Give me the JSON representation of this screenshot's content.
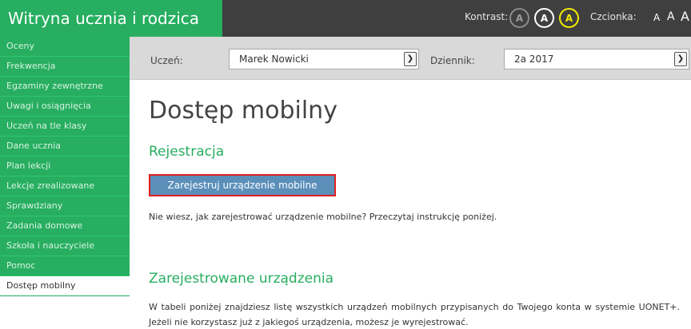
{
  "header": {
    "title": "Witryna ucznia i rodzica",
    "contrast_label": "Kontrast:",
    "contrast_options": [
      "A",
      "A",
      "A"
    ],
    "font_label": "Czcionka:",
    "font_sizes": [
      "A",
      "A",
      "A"
    ],
    "colors": {
      "brand": "#27ae60",
      "bar": "#3f3f3f",
      "contrast_active": "#f2ea00"
    }
  },
  "sidebar": {
    "items": [
      {
        "label": "Oceny"
      },
      {
        "label": "Frekwencja"
      },
      {
        "label": "Egzaminy zewnętrzne"
      },
      {
        "label": "Uwagi i osiągnięcia"
      },
      {
        "label": "Uczeń na tle klasy"
      },
      {
        "label": "Dane ucznia"
      },
      {
        "label": "Plan lekcji"
      },
      {
        "label": "Lekcje zrealizowane"
      },
      {
        "label": "Sprawdziany"
      },
      {
        "label": "Zadania domowe"
      },
      {
        "label": "Szkoła i nauczyciele"
      },
      {
        "label": "Pomoc"
      },
      {
        "label": "Dostęp mobilny",
        "active": true
      }
    ]
  },
  "filters": {
    "student_label": "Uczeń:",
    "student_value": "Marek Nowicki",
    "journal_label": "Dziennik:",
    "journal_value": "2a 2017"
  },
  "main": {
    "title": "Dostęp mobilny",
    "registration_heading": "Rejestracja",
    "register_button": "Zarejestruj urządzenie mobilne",
    "help_text": "Nie wiesz, jak zarejestrować urządzenie mobilne? Przeczytaj instrukcję poniżej.",
    "devices_heading": "Zarejestrowane urządzenia",
    "devices_description": "W tabeli poniżej znajdziesz listę wszystkich urządzeń mobilnych przypisanych do Twojego konta w systemie UONET+. Jeżeli nie korzystasz już z jakiegoś urządzenia, możesz je wyrejestrować."
  }
}
